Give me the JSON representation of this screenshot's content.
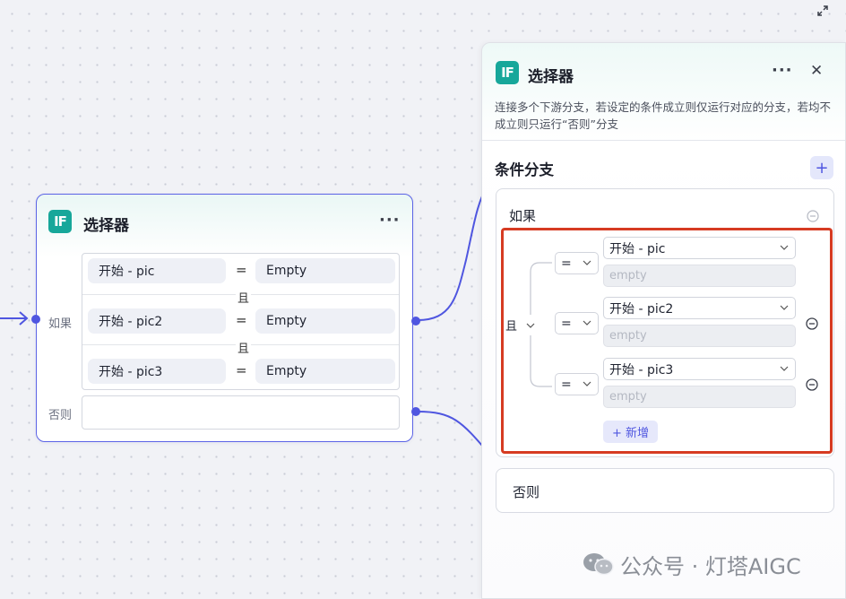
{
  "node": {
    "icon_text": "IF",
    "title": "选择器",
    "more": "···",
    "if_label": "如果",
    "else_label": "否则",
    "conditions": [
      {
        "left": "开始  -  pic",
        "op": "=",
        "right": "Empty"
      },
      {
        "left": "开始  -  pic2",
        "op": "=",
        "right": "Empty"
      },
      {
        "left": "开始  -  pic3",
        "op": "=",
        "right": "Empty"
      }
    ],
    "and_label": "且"
  },
  "panel": {
    "icon_text": "IF",
    "title": "选择器",
    "more": "···",
    "close": "✕",
    "description": "连接多个下游分支，若设定的条件成立则仅运行对应的分支，若均不成立则只运行“否则”分支",
    "section_title": "条件分支",
    "add": "+",
    "if_label": "如果",
    "logic": "且",
    "conditions": [
      {
        "op": "=",
        "variable": "开始 - pic",
        "placeholder": "empty"
      },
      {
        "op": "=",
        "variable": "开始 - pic2",
        "placeholder": "empty"
      },
      {
        "op": "=",
        "variable": "开始 - pic3",
        "placeholder": "empty"
      }
    ],
    "add_condition": "+ 新增",
    "else_label": "否则"
  },
  "watermark": {
    "text": "公众号 · 灯塔AIGC"
  },
  "colors": {
    "accent": "#4f56e0",
    "badge": "#17a79a",
    "highlight": "#d63b22"
  }
}
